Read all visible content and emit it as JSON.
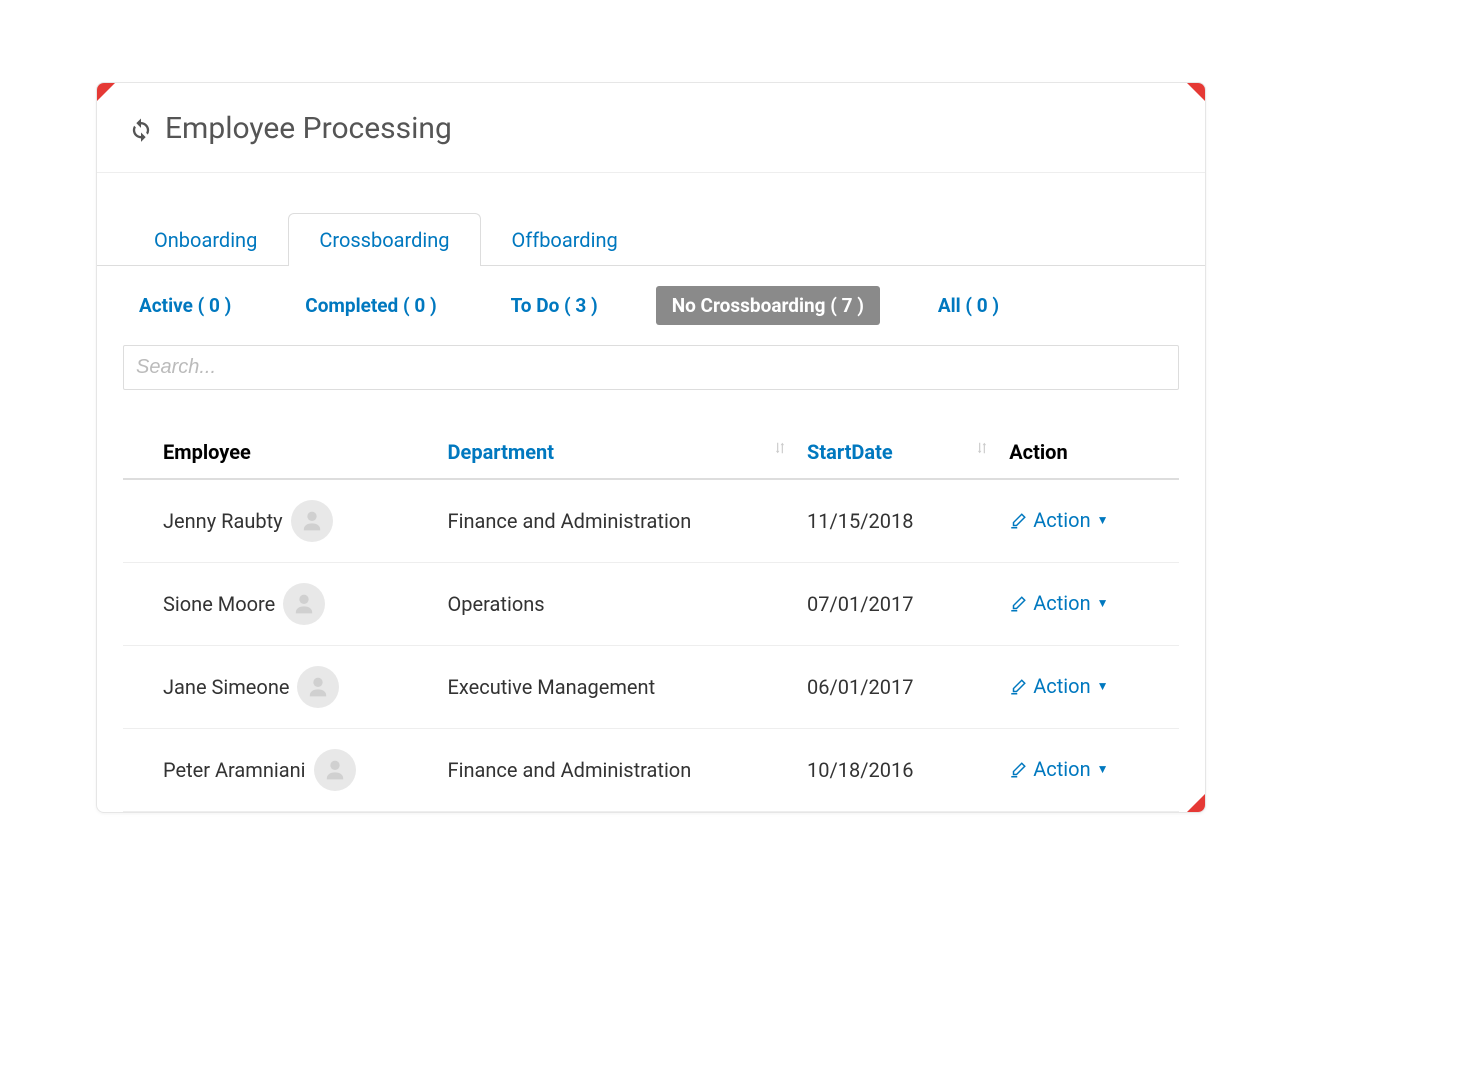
{
  "header": {
    "title": "Employee Processing"
  },
  "tabs_primary": [
    {
      "label": "Onboarding",
      "active": false
    },
    {
      "label": "Crossboarding",
      "active": true
    },
    {
      "label": "Offboarding",
      "active": false
    }
  ],
  "tabs_secondary": [
    {
      "label": "Active ( 0 )",
      "active": false
    },
    {
      "label": "Completed ( 0 )",
      "active": false
    },
    {
      "label": "To Do ( 3 )",
      "active": false
    },
    {
      "label": "No Crossboarding ( 7 )",
      "active": true
    },
    {
      "label": "All ( 0 )",
      "active": false
    }
  ],
  "search": {
    "placeholder": "Search..."
  },
  "table": {
    "columns": {
      "employee": "Employee",
      "department": "Department",
      "startdate": "StartDate",
      "action": "Action"
    },
    "action_label": "Action",
    "rows": [
      {
        "name": "Jenny Raubty",
        "department": "Finance and Administration",
        "startdate": "11/15/2018"
      },
      {
        "name": "Sione Moore",
        "department": "Operations",
        "startdate": "07/01/2017"
      },
      {
        "name": "Jane Simeone",
        "department": "Executive Management",
        "startdate": "06/01/2017"
      },
      {
        "name": "Peter Aramniani",
        "department": "Finance and Administration",
        "startdate": "10/18/2016"
      }
    ]
  }
}
